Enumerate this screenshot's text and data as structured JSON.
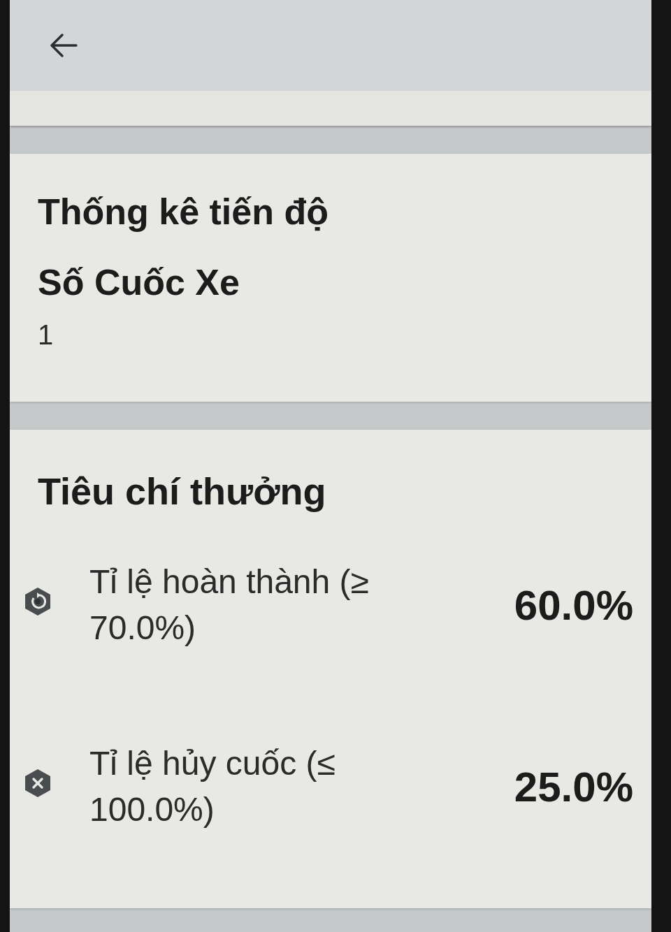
{
  "progress_card": {
    "title": "Thống kê tiến độ",
    "stat_label": "Số Cuốc Xe",
    "stat_value": "1"
  },
  "criteria_card": {
    "title": "Tiêu chí thưởng",
    "criteria": [
      {
        "label": "Tỉ lệ hoàn thành (≥ 70.0%)",
        "value": "60.0%",
        "kind": "pending"
      },
      {
        "label": "Tỉ lệ hủy cuốc (≤ 100.0%)",
        "value": "25.0%",
        "kind": "failed"
      }
    ]
  }
}
